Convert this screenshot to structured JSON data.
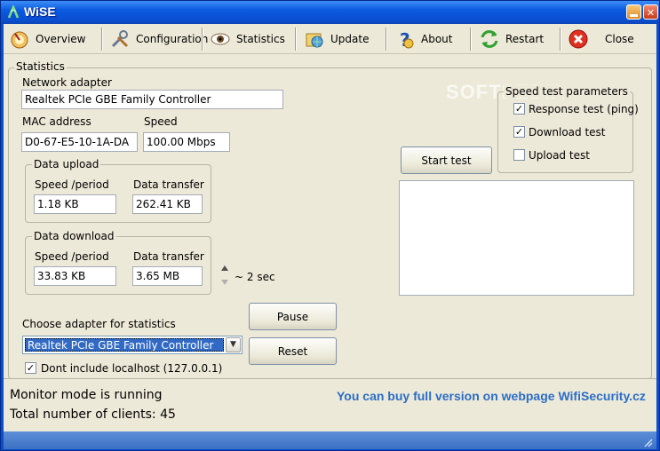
{
  "window": {
    "title": "WiSE"
  },
  "toolbar": {
    "overview": "Overview",
    "configuration": "Configuration",
    "statistics": "Statistics",
    "update": "Update",
    "about": "About",
    "restart": "Restart",
    "close": "Close"
  },
  "stats": {
    "group_title": "Statistics",
    "network_adapter_label": "Network adapter",
    "network_adapter_value": "Realtek PCIe GBE Family Controller",
    "mac_label": "MAC address",
    "mac_value": "D0-67-E5-10-1A-DA",
    "speed_label": "Speed",
    "speed_value": "100.00 Mbps",
    "upload": {
      "title": "Data upload",
      "speed_label": "Speed /period",
      "transfer_label": "Data transfer",
      "speed_value": "1.18 KB",
      "transfer_value": "262.41 KB"
    },
    "download": {
      "title": "Data download",
      "speed_label": "Speed /period",
      "transfer_label": "Data transfer",
      "speed_value": "33.83 KB",
      "transfer_value": "3.65 MB"
    },
    "period_value": "~ 2 sec",
    "choose_adapter_label": "Choose adapter for statistics",
    "adapter_selected": "Realtek PCIe GBE Family Controller",
    "pause_label": "Pause",
    "reset_label": "Reset",
    "exclude_localhost_label": "Dont include localhost (127.0.0.1)",
    "exclude_localhost_checked": "✓"
  },
  "speed_test": {
    "title": "Speed test parameters",
    "response_label": "Response test (ping)",
    "response_checked": "✓",
    "download_label": "Download test",
    "download_checked": "✓",
    "upload_label": "Upload test",
    "upload_checked": "",
    "start_label": "Start test"
  },
  "status": {
    "monitor_mode": "Monitor mode is running",
    "clients": "Total number of clients: 45",
    "promo": "You can buy full version on webpage WifiSecurity.cz"
  },
  "watermark": "SOFTPEDIA"
}
